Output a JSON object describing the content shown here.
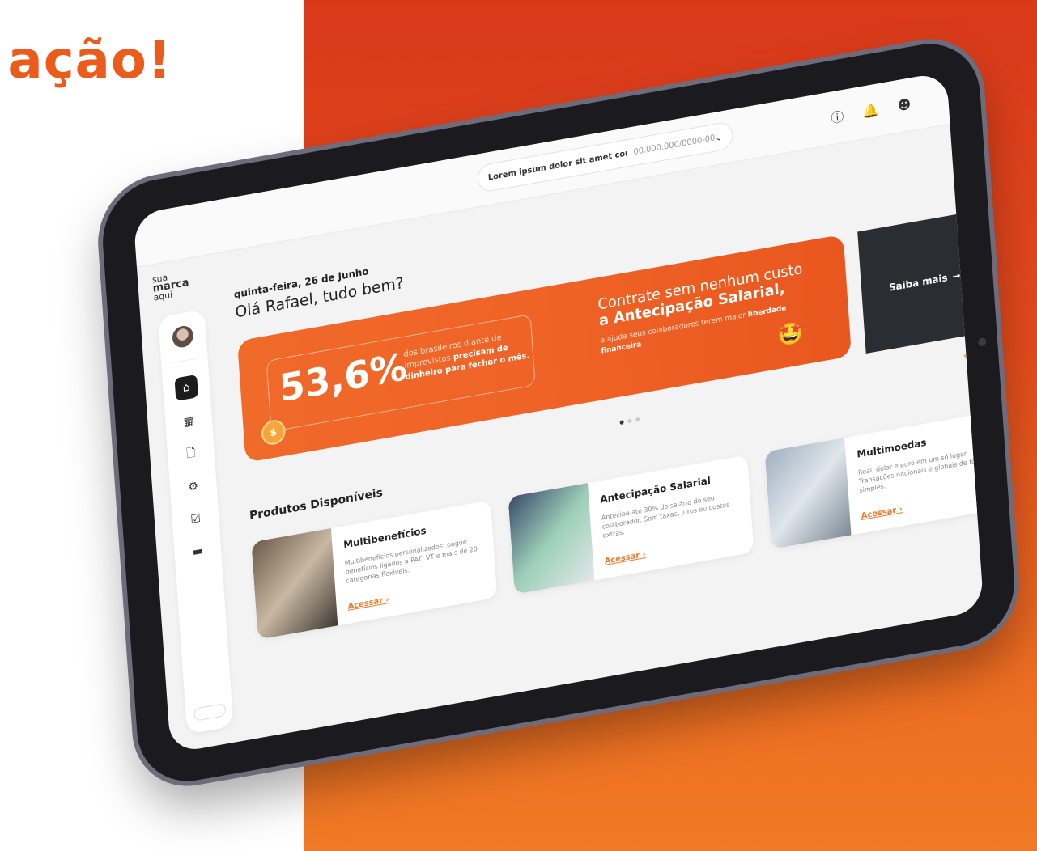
{
  "headline": "ação!",
  "topbar": {
    "company_name": "Lorem ipsum dolor sit amet consect...",
    "company_cnpj": "00.000.000/0000-00",
    "dropdown_icon": "chevron-down-icon",
    "help_icon": "help-icon",
    "notification_icon": "bell-icon",
    "accessibility_icon": "accessibility-icon"
  },
  "logo": {
    "line1": "sua",
    "line2": "marca",
    "line3": "aqui"
  },
  "sidebar": {
    "items": [
      {
        "icon": "home-icon"
      },
      {
        "icon": "grid-icon"
      },
      {
        "icon": "document-icon"
      },
      {
        "icon": "gear-icon"
      },
      {
        "icon": "card-check-icon"
      },
      {
        "icon": "credit-card-icon"
      }
    ]
  },
  "greeting": {
    "date": "quinta-feira, 26 de Junho",
    "message": "Olá Rafael, tudo bem?"
  },
  "banner": {
    "percent": "53,6%",
    "desc_prefix": "dos brasileiros diante de imprevistos",
    "desc_bold": "precisam de dinheiro para fechar o mês.",
    "title_line1": "Contrate sem nenhum custo",
    "title_line2": "a Antecipação Salarial,",
    "sub_prefix": "e ajude seus colaboradores terem maior",
    "sub_bold": "liberdade financeira",
    "cta": "Saiba mais"
  },
  "products": {
    "section_title": "Produtos Disponíveis",
    "cards": [
      {
        "title": "Multibenefícios",
        "desc": "Multibenefícios personalizados: pague benefícios ligados a PAT, VT e mais de 20 categorias flexíveis.",
        "cta": "Acessar"
      },
      {
        "title": "Antecipação Salarial",
        "desc": "Antecipe até 30% do salário do seu colaborador. Sem taxas, juros ou custos extras.",
        "cta": "Acessar"
      },
      {
        "title": "Multimoedas",
        "desc": "Real, dólar e euro em um só lugar. Transações nacionais e globais de forma simples.",
        "cta": "Acessar"
      }
    ]
  },
  "colors": {
    "brand_orange": "#ef6326",
    "dark": "#2a2e33"
  }
}
